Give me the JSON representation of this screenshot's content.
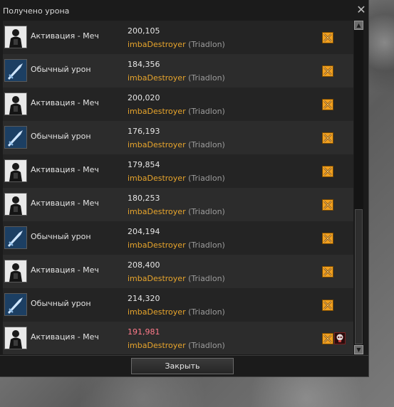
{
  "window": {
    "title": "Получено урона",
    "close_glyph": "✕"
  },
  "rows": [
    {
      "icon": "sword-activation-icon",
      "skill": "Активация - Меч",
      "damage": "200,105",
      "attacker": "imbaDestroyer",
      "faction": "(Triadlon)",
      "crit": false,
      "extra": false
    },
    {
      "icon": "normal-damage-icon",
      "skill": "Обычный урон",
      "damage": "184,356",
      "attacker": "imbaDestroyer",
      "faction": "(Triadlon)",
      "crit": false,
      "extra": false
    },
    {
      "icon": "sword-activation-icon",
      "skill": "Активация - Меч",
      "damage": "200,020",
      "attacker": "imbaDestroyer",
      "faction": "(Triadlon)",
      "crit": false,
      "extra": false
    },
    {
      "icon": "normal-damage-icon",
      "skill": "Обычный урон",
      "damage": "176,193",
      "attacker": "imbaDestroyer",
      "faction": "(Triadlon)",
      "crit": false,
      "extra": false
    },
    {
      "icon": "sword-activation-icon",
      "skill": "Активация - Меч",
      "damage": "179,854",
      "attacker": "imbaDestroyer",
      "faction": "(Triadlon)",
      "crit": false,
      "extra": false
    },
    {
      "icon": "sword-activation-icon",
      "skill": "Активация - Меч",
      "damage": "180,253",
      "attacker": "imbaDestroyer",
      "faction": "(Triadlon)",
      "crit": false,
      "extra": false
    },
    {
      "icon": "normal-damage-icon",
      "skill": "Обычный урон",
      "damage": "204,194",
      "attacker": "imbaDestroyer",
      "faction": "(Triadlon)",
      "crit": false,
      "extra": false
    },
    {
      "icon": "sword-activation-icon",
      "skill": "Активация - Меч",
      "damage": "208,400",
      "attacker": "imbaDestroyer",
      "faction": "(Triadlon)",
      "crit": false,
      "extra": false
    },
    {
      "icon": "normal-damage-icon",
      "skill": "Обычный урон",
      "damage": "214,320",
      "attacker": "imbaDestroyer",
      "faction": "(Triadlon)",
      "crit": false,
      "extra": false
    },
    {
      "icon": "sword-activation-icon",
      "skill": "Активация - Меч",
      "damage": "191,981",
      "attacker": "imbaDestroyer",
      "faction": "(Triadlon)",
      "crit": true,
      "extra": true
    }
  ],
  "footer": {
    "close_button": "Закрыть"
  },
  "colors": {
    "attacker": "#e8a52c",
    "crit_damage": "#ff7a8a",
    "badge": "#f0a020"
  }
}
